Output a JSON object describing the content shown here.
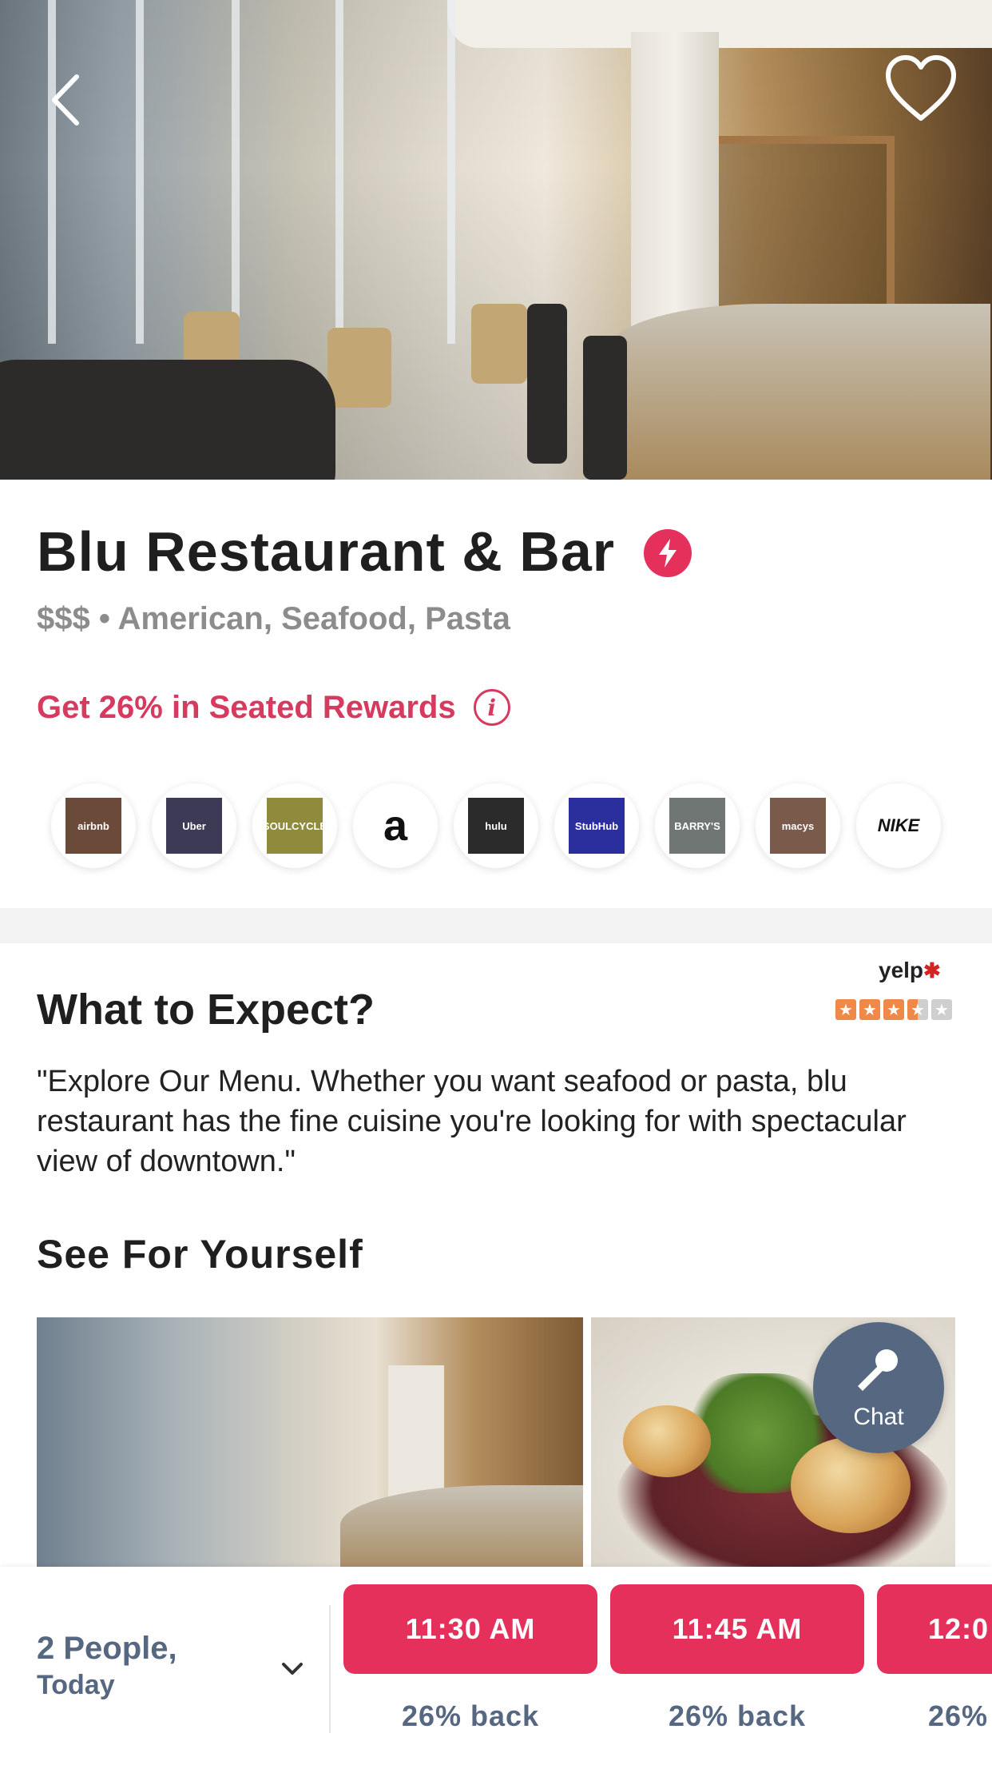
{
  "restaurant": {
    "name": "Blu Restaurant & Bar",
    "price": "$$$",
    "separator": "•",
    "cuisines": "American, Seafood, Pasta",
    "rewards": "Get 26% in Seated Rewards"
  },
  "partners": [
    {
      "name": "airbnb",
      "label": "airbnb",
      "bg": "#6b4a3a"
    },
    {
      "name": "uber",
      "label": "Uber",
      "bg": "#3c3a55"
    },
    {
      "name": "soulcycle",
      "label": "SOULCYCLE",
      "bg": "#8f8a3c"
    },
    {
      "name": "amazon",
      "label": "a",
      "bg": "#ffffff"
    },
    {
      "name": "hulu",
      "label": "hulu",
      "bg": "#2b2b2b"
    },
    {
      "name": "stubhub",
      "label": "StubHub",
      "bg": "#2b2f9e"
    },
    {
      "name": "barrys",
      "label": "BARRY'S",
      "bg": "#6f7674"
    },
    {
      "name": "macys",
      "label": "macys",
      "bg": "#7a5a4b"
    },
    {
      "name": "nike",
      "label": "NIKE",
      "bg": "#ffffff"
    }
  ],
  "expect": {
    "title": "What to Expect?",
    "description": "\"Explore Our Menu. Whether you want seafood or pasta, blu restaurant has the fine cuisine you're looking for with spectacular view of downtown.\"",
    "yelp_logo": "yelp",
    "yelp_rating": 3.5,
    "yelp_rating_max": 5
  },
  "gallery": {
    "title": "See For Yourself"
  },
  "chat": {
    "label": "Chat"
  },
  "booking": {
    "party_line1": "2 People,",
    "party_line2": "Today",
    "slots": [
      {
        "time": "11:30 AM",
        "back": "26% back"
      },
      {
        "time": "11:45 AM",
        "back": "26% back"
      },
      {
        "time": "12:0",
        "back": "26%"
      }
    ]
  },
  "colors": {
    "accent": "#e5305b",
    "rewards": "#d63a5f",
    "slate": "#566782",
    "yelp_star": "#f0884a"
  }
}
